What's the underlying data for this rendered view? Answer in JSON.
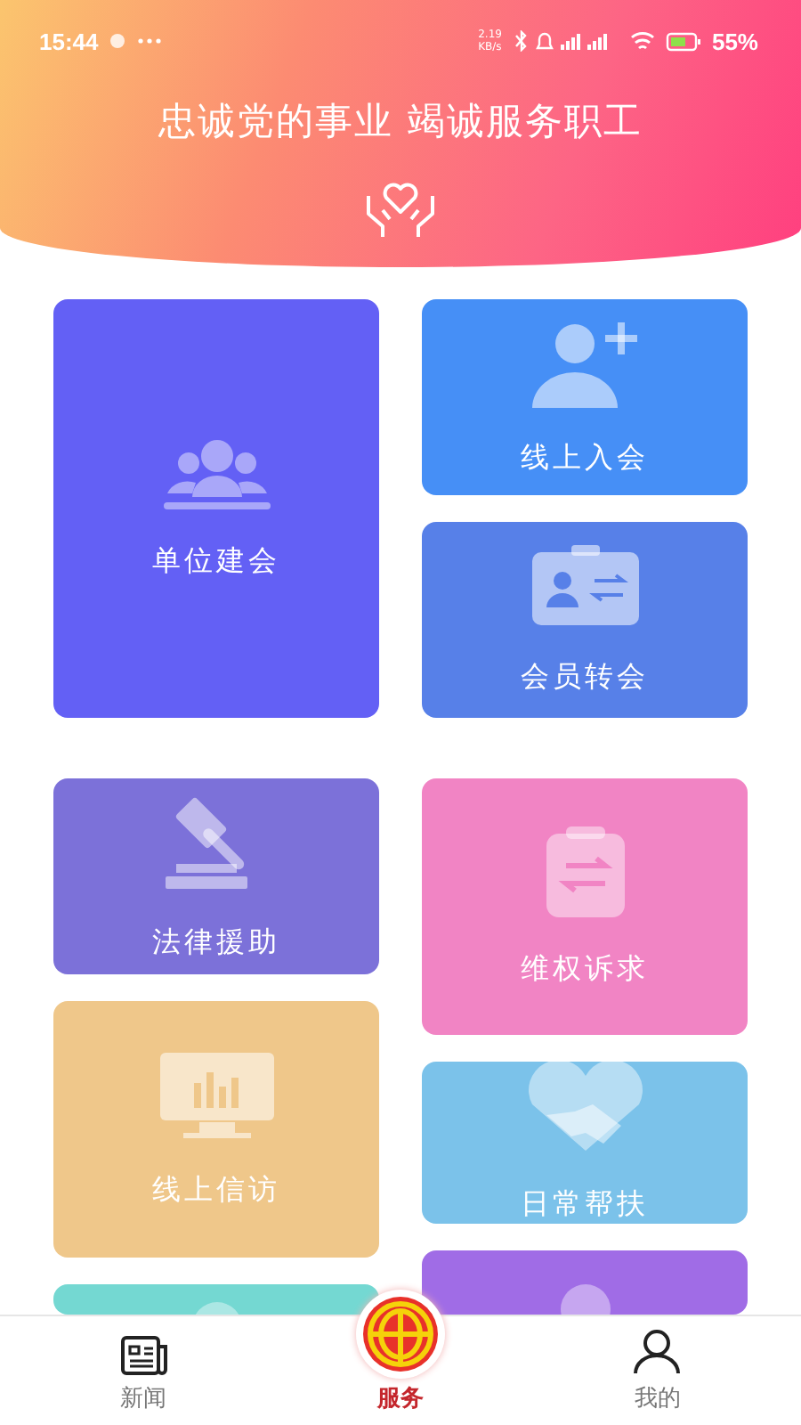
{
  "status_bar": {
    "time": "15:44",
    "net_speed": "2.19",
    "net_unit": "KB/s",
    "battery": "55%"
  },
  "header": {
    "slogan": "忠诚党的事业 竭诚服务职工"
  },
  "columns": [
    {
      "tiles": [
        {
          "label": "单位建会",
          "color": "#6360f5"
        },
        {
          "label": "法律援助",
          "color": "#7c71d9"
        },
        {
          "label": "线上信访",
          "color": "#efc78a"
        },
        {
          "color": "#74d8d2"
        }
      ]
    },
    {
      "tiles": [
        {
          "label": "线上入会",
          "color": "#468ff6"
        },
        {
          "label": "会员转会",
          "color": "#5780e8"
        },
        {
          "label": "维权诉求",
          "color": "#f184c4"
        },
        {
          "label": "日常帮扶",
          "color": "#7bc2ea"
        },
        {
          "color": "#a06ce6"
        }
      ]
    }
  ],
  "nav": [
    {
      "label": "新闻",
      "selected": false
    },
    {
      "label": "服务",
      "selected": true
    },
    {
      "label": "我的",
      "selected": false
    }
  ]
}
